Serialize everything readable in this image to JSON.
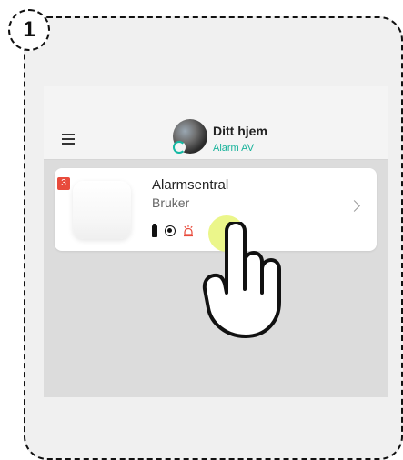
{
  "step": {
    "number": "1"
  },
  "header": {
    "title": "Ditt hjem",
    "subtitle": "Alarm AV"
  },
  "device": {
    "count_badge": "3",
    "title": "Alarmsentral",
    "subtitle": "Bruker"
  },
  "icons": {
    "menu": "menu-icon",
    "avatar": "home-avatar",
    "battery": "battery-icon",
    "signal": "signal-4g-icon",
    "alarm": "alarm-icon",
    "chevron": "chevron-right-icon",
    "hand": "hand-pointer-icon"
  },
  "colors": {
    "accent_green": "#19b39b",
    "badge_red": "#e84b3c",
    "tap_yellow": "#e7f576"
  }
}
